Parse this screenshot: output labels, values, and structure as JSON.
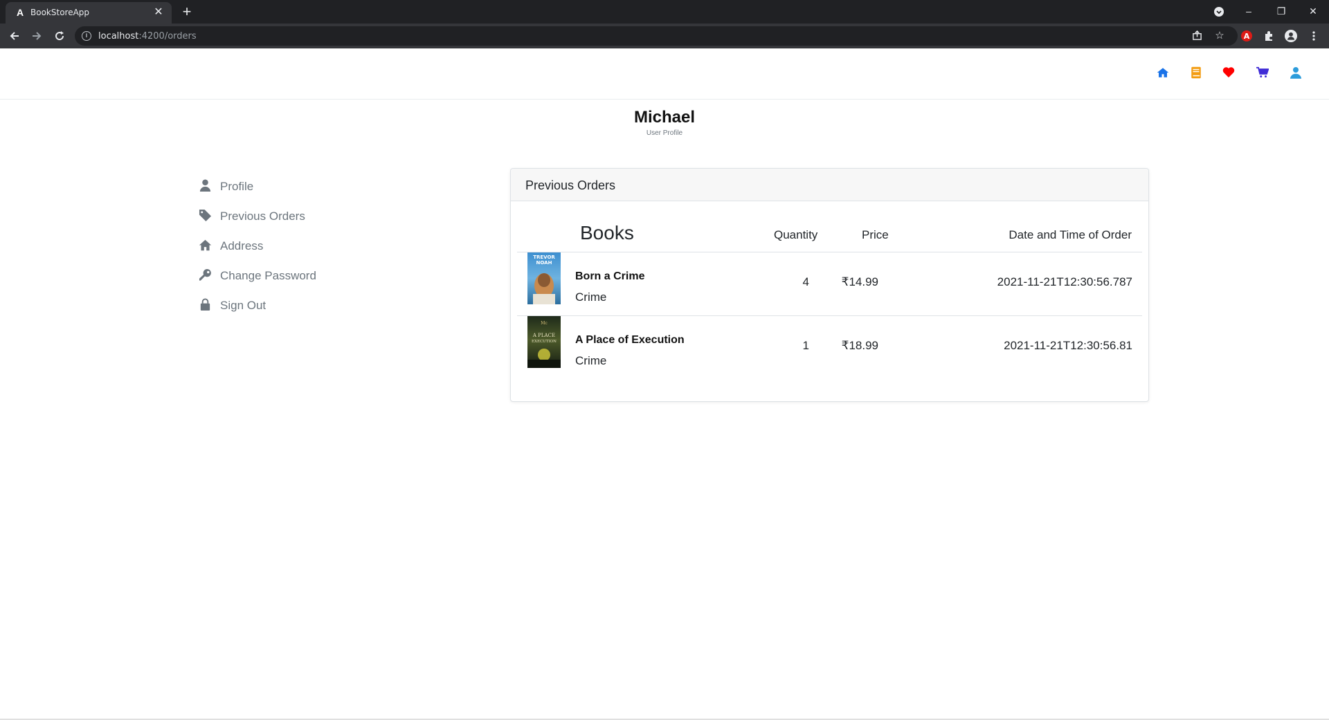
{
  "browser": {
    "tab_title": "BookStoreApp",
    "tab_favicon": "A",
    "new_tab": "+",
    "url_host": "localhost",
    "url_rest": ":4200/orders",
    "window_minimize": "–",
    "window_restore": "❐",
    "window_close": "✕"
  },
  "header": {
    "icons": [
      {
        "name": "home-icon",
        "color": "#1a73e8"
      },
      {
        "name": "book-icon",
        "color": "#f39c12"
      },
      {
        "name": "heart-icon",
        "color": "#ff0000"
      },
      {
        "name": "cart-icon",
        "color": "#3f2bd6"
      },
      {
        "name": "user-icon",
        "color": "#2d9cdb"
      }
    ]
  },
  "profile": {
    "name": "Michael",
    "subtitle": "User Profile"
  },
  "sidebar": {
    "items": [
      {
        "label": "Profile",
        "icon": "user-icon"
      },
      {
        "label": "Previous Orders",
        "icon": "tag-icon"
      },
      {
        "label": "Address",
        "icon": "home-icon"
      },
      {
        "label": "Change Password",
        "icon": "key-icon"
      },
      {
        "label": "Sign Out",
        "icon": "lock-icon"
      }
    ]
  },
  "orders": {
    "card_title": "Previous Orders",
    "columns": {
      "books": "Books",
      "quantity": "Quantity",
      "price": "Price",
      "date": "Date and Time of Order"
    },
    "rows": [
      {
        "title": "Born a Crime",
        "category": "Crime",
        "quantity": "4",
        "price": "₹14.99",
        "date": "2021-11-21T12:30:56.787",
        "cover_text": [
          "TREVOR",
          "NOAH"
        ]
      },
      {
        "title": "A Place of Execution",
        "category": "Crime",
        "quantity": "1",
        "price": "₹18.99",
        "date": "2021-11-21T12:30:56.81",
        "cover_text": [
          "A PLACE",
          "EXECUTION"
        ]
      }
    ]
  }
}
